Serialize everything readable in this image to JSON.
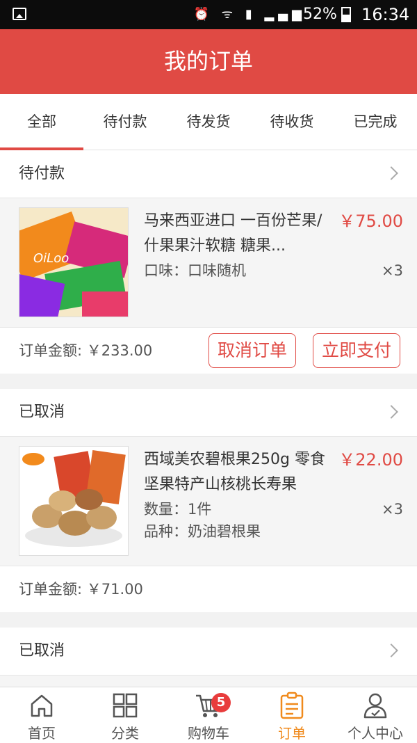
{
  "status_bar": {
    "battery": "52%",
    "time": "16:34"
  },
  "header": {
    "title": "我的订单"
  },
  "tabs": [
    {
      "label": "全部"
    },
    {
      "label": "待付款"
    },
    {
      "label": "待发货"
    },
    {
      "label": "待收货"
    },
    {
      "label": "已完成"
    }
  ],
  "orders": [
    {
      "status": "待付款",
      "item": {
        "title": "马来西亚进口 一百份芒果/什果果汁软糖 糖果...",
        "price": "￥75.00",
        "spec1": "口味：口味随机",
        "qty": "×3"
      },
      "total": "订单金额: ￥233.00",
      "cancel_label": "取消订单",
      "pay_label": "立即支付"
    },
    {
      "status": "已取消",
      "item": {
        "title": "西域美农碧根果250g 零食坚果特产山核桃长寿果",
        "price": "￥22.00",
        "spec1": "数量：1件",
        "spec2": "品种：奶油碧根果",
        "qty": "×3"
      },
      "total": "订单金额: ￥71.00"
    },
    {
      "status": "已取消"
    }
  ],
  "bottom_nav": [
    {
      "label": "首页",
      "icon": "home-icon"
    },
    {
      "label": "分类",
      "icon": "category-grid-icon"
    },
    {
      "label": "购物车",
      "icon": "cart-icon",
      "badge": "5"
    },
    {
      "label": "订单",
      "icon": "orders-icon"
    },
    {
      "label": "个人中心",
      "icon": "user-icon"
    }
  ],
  "colors": {
    "accent": "#e04a44",
    "nav_active": "#f08a1c"
  }
}
